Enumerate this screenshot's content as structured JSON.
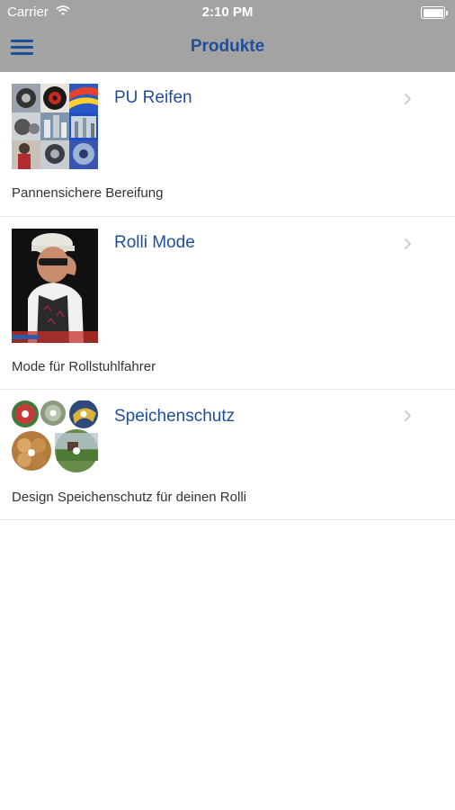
{
  "status_bar": {
    "carrier": "Carrier",
    "time": "2:10 PM"
  },
  "nav": {
    "title": "Produkte"
  },
  "items": [
    {
      "title": "PU Reifen",
      "subtitle": "Pannensichere Bereifung",
      "image": "tire-collage-thumbnail"
    },
    {
      "title": "Rolli Mode",
      "subtitle": "Mode für Rollstuhlfahrer",
      "image": "fashion-model-thumbnail"
    },
    {
      "title": "Speichenschutz",
      "subtitle": "Design Speichenschutz für deinen Rolli",
      "image": "spoke-guard-designs-thumbnail"
    }
  ],
  "icons": {
    "menu": "hamburger-menu-icon",
    "chevron": "chevron-right-icon",
    "wifi": "wifi-icon",
    "battery": "battery-icon"
  },
  "colors": {
    "bar": "#a3a3a3",
    "accent": "#1f4f9b",
    "chevron": "#c7c7cc"
  }
}
